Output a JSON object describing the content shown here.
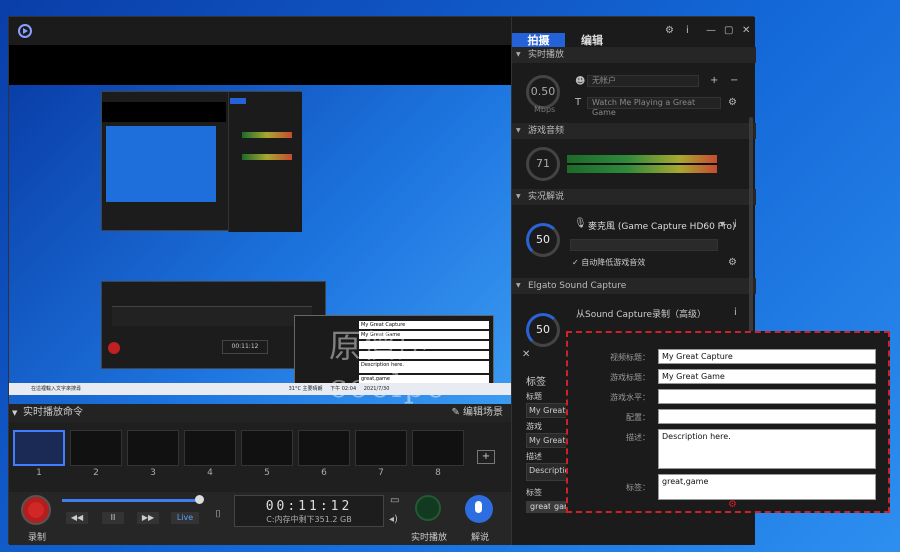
{
  "app": {
    "scene_bar_title": "实时播放命令",
    "edit_scenes": "编辑场景",
    "scenes": [
      "1",
      "2",
      "3",
      "4",
      "5",
      "6",
      "7",
      "8"
    ]
  },
  "controls": {
    "record_label": "录制",
    "rewind": "◀◀",
    "pause": "II",
    "forward": "▶▶",
    "live": "Live",
    "timer": "00:11:12",
    "disk": "C:内存中剩下351.2 GB",
    "stream_label": "实时播放",
    "commentary_label": "解说"
  },
  "preview": {
    "taskbar_search": "在這裡輸入文字來搜尋",
    "weather": "31°C 主要晴朗",
    "time": "下午 02:04",
    "date": "2021/7/30",
    "watermark": "原價屋coolpc",
    "mini_fields": [
      "My Great Capture",
      "My Great Game",
      "",
      "",
      "Description here.",
      "great,game"
    ]
  },
  "side": {
    "tab_capture": "拍摄",
    "tab_edit": "编辑",
    "sec_stream": "实时播放",
    "stream_dial": "0.50",
    "stream_unit": "Mbps",
    "account": "无帐户",
    "stream_title": "Watch Me Playing a Great Game",
    "sec_game_audio": "游戏音频",
    "game_dial": "71",
    "sec_commentary": "实况解说",
    "mic_dial": "50",
    "mic_name": "麥克風 (Game Capture HD60 Pro)",
    "auto_duck": "自动降低游戏音效",
    "sec_sound_capture": "Elgato Sound Capture",
    "sound_capture_name": "从Sound Capture录制（高级）",
    "sc_dial": "50",
    "tags_header": "标签",
    "title_label": "标题",
    "title_value": "My Great Capture",
    "game_label": "游戏",
    "game_value": "My Great Game",
    "desc_label": "描述",
    "desc_value": "Description here",
    "tags_label": "标签",
    "tags": [
      "great",
      "game"
    ]
  },
  "popup": {
    "rows": [
      {
        "label": "视频标题：",
        "value": "My Great Capture"
      },
      {
        "label": "游戏标题：",
        "value": "My Great Game"
      },
      {
        "label": "游戏水平：",
        "value": ""
      },
      {
        "label": "配置：",
        "value": ""
      },
      {
        "label": "描述：",
        "value": "Description here."
      },
      {
        "label": "标签：",
        "value": "great,game"
      }
    ]
  }
}
